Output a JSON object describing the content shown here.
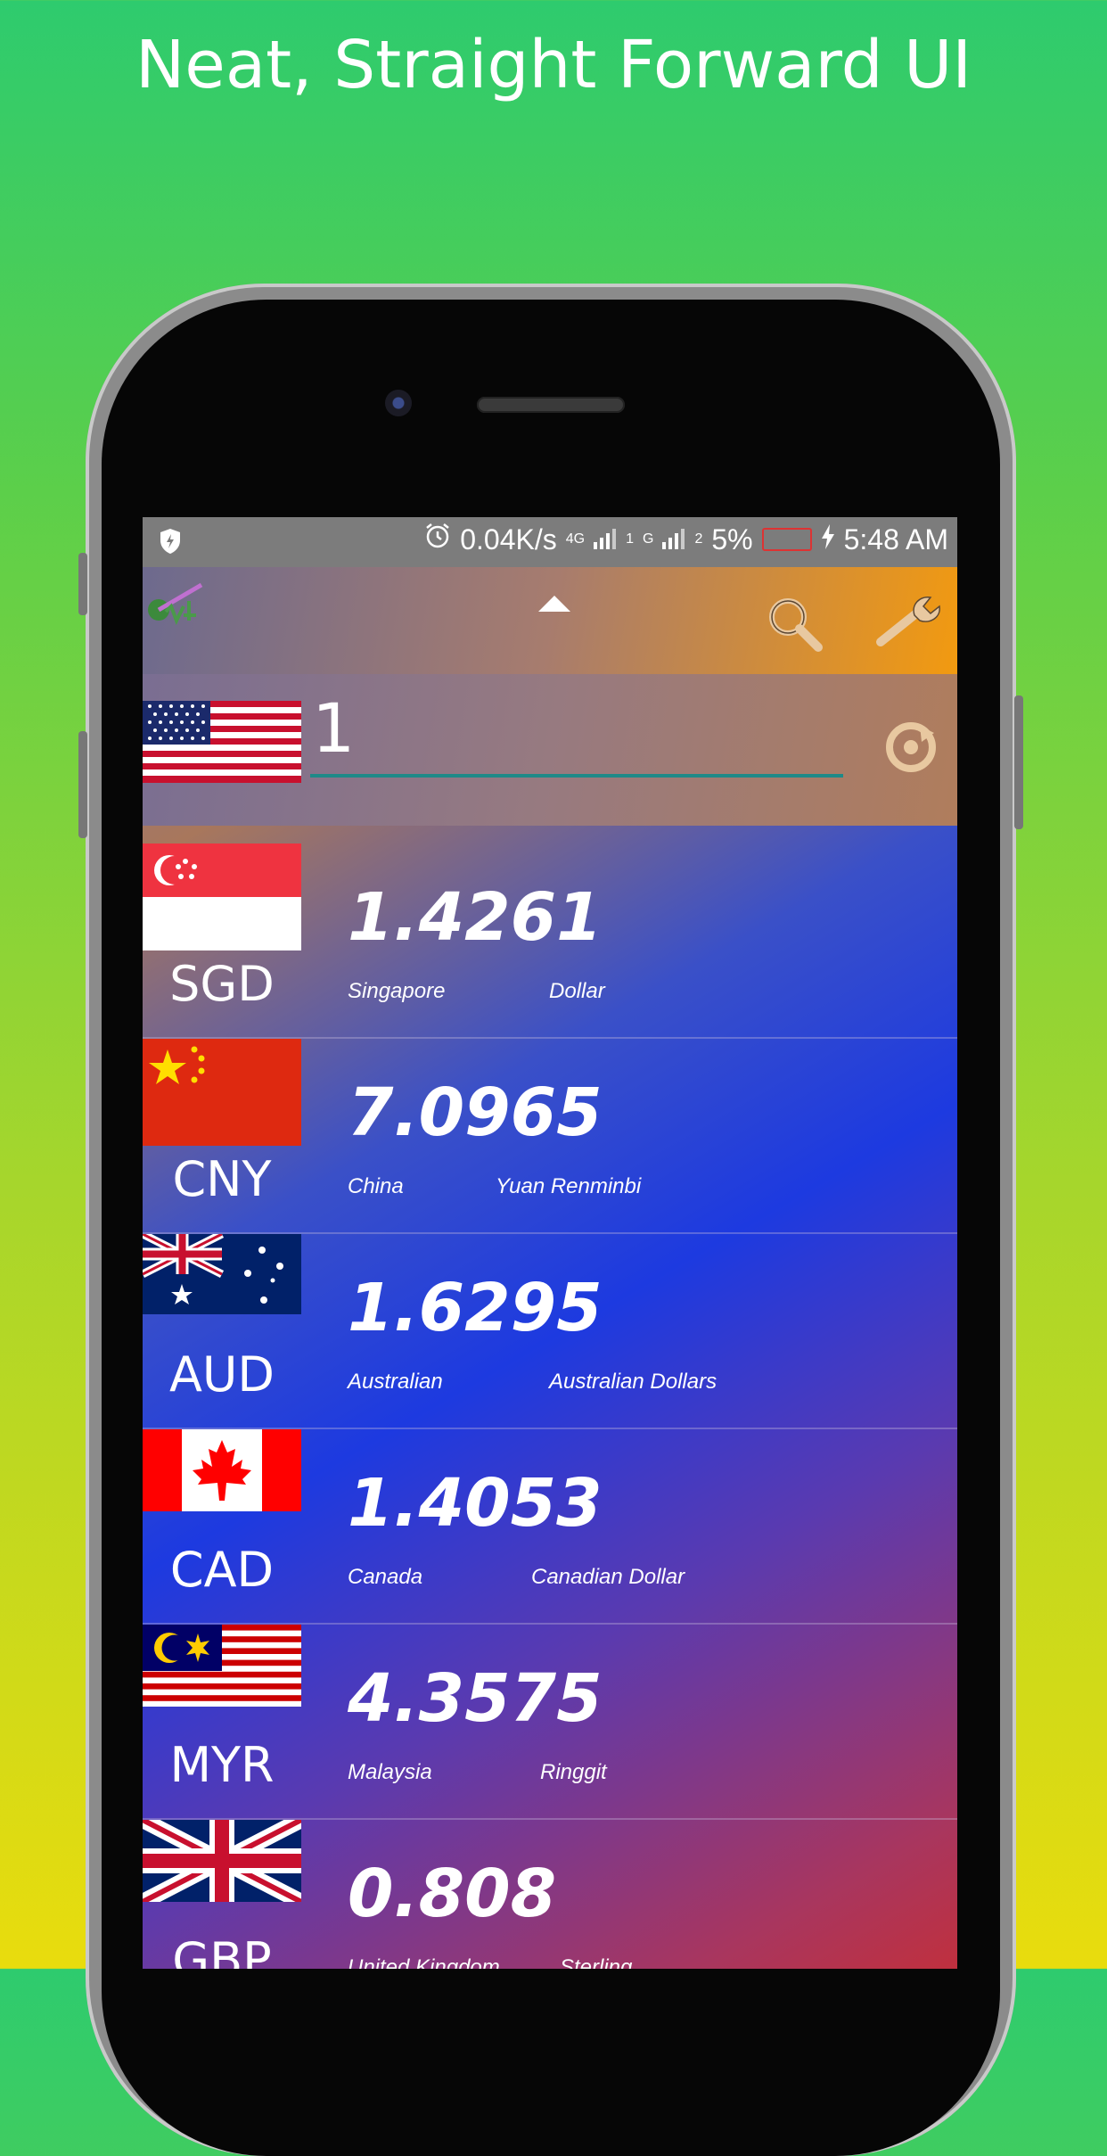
{
  "headline": "Neat, Straight Forward UI",
  "status_bar": {
    "speed": "0.04K/s",
    "net1": "4G",
    "sim1": "1",
    "net2": "G",
    "sim2": "2",
    "battery": "5%",
    "time": "5:48 AM"
  },
  "converter": {
    "base_currency_flag": "us-flag",
    "amount": "1"
  },
  "rates": [
    {
      "code": "SGD",
      "value": "1.4261",
      "country": "Singapore",
      "name": "Dollar",
      "flag": "sg-flag"
    },
    {
      "code": "CNY",
      "value": "7.0965",
      "country": "China",
      "name": "Yuan Renminbi",
      "flag": "cn-flag"
    },
    {
      "code": "AUD",
      "value": "1.6295",
      "country": "Australian",
      "name": "Australian Dollars",
      "flag": "au-flag"
    },
    {
      "code": "CAD",
      "value": "1.4053",
      "country": "Canada",
      "name": "Canadian Dollar",
      "flag": "ca-flag"
    },
    {
      "code": "MYR",
      "value": "4.3575",
      "country": "Malaysia",
      "name": "Ringgit",
      "flag": "my-flag"
    },
    {
      "code": "GBP",
      "value": "0.808",
      "country": "United Kingdom",
      "name": "Sterling",
      "flag": "gb-flag"
    }
  ],
  "colors": {
    "accent_underline": "#1e8a88",
    "toolbar_orange": "#f29a10",
    "icon_tan": "#e8c8a0"
  }
}
